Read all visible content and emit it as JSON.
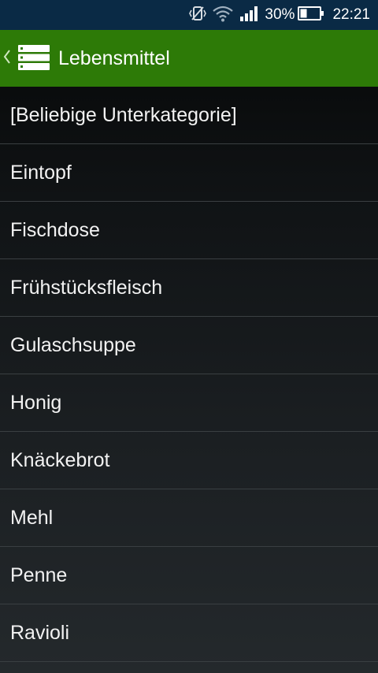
{
  "status_bar": {
    "battery_percent": "30%",
    "time": "22:21",
    "icons": [
      "vibrate-icon",
      "wifi-icon",
      "signal-icon",
      "battery-icon"
    ],
    "background_color": "#0a2a45"
  },
  "action_bar": {
    "title": "Lebensmittel",
    "icon": "list-icon",
    "up_icon": "chevron-left-icon",
    "background_color": "#2d7a07"
  },
  "list": {
    "items": [
      {
        "label": "[Beliebige Unterkategorie]"
      },
      {
        "label": "Eintopf"
      },
      {
        "label": "Fischdose"
      },
      {
        "label": "Frühstücksfleisch"
      },
      {
        "label": "Gulaschsuppe"
      },
      {
        "label": "Honig"
      },
      {
        "label": "Knäckebrot"
      },
      {
        "label": "Mehl"
      },
      {
        "label": "Penne"
      },
      {
        "label": "Ravioli"
      }
    ]
  }
}
